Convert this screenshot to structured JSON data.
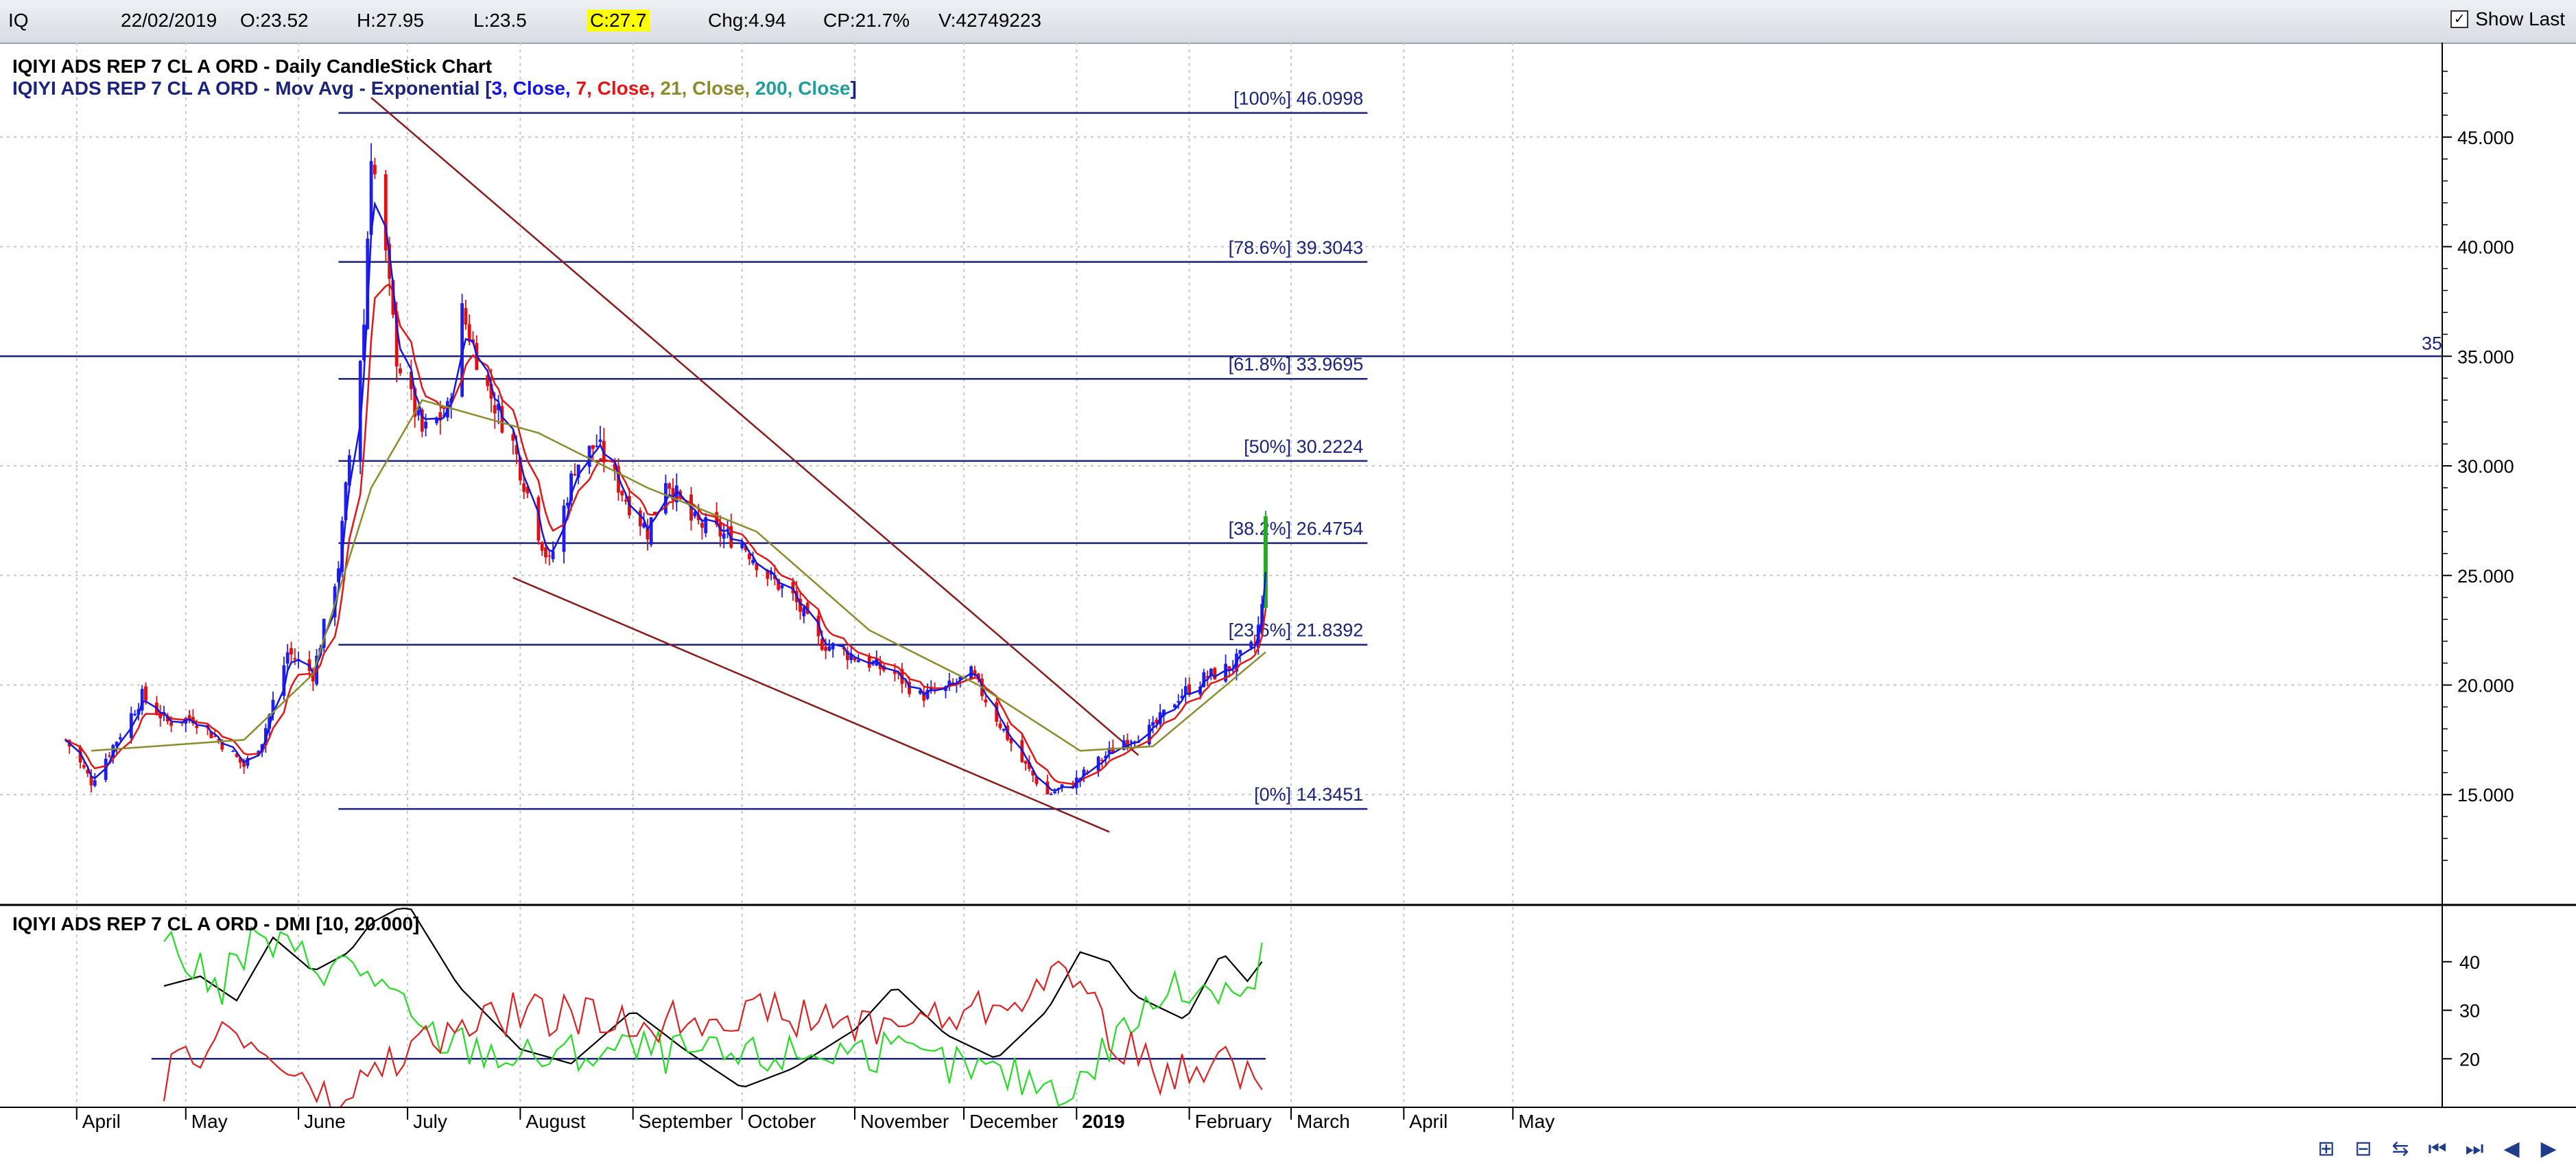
{
  "info_bar": {
    "symbol": "IQ",
    "date": "22/02/2019",
    "open": "O:23.52",
    "high": "H:27.95",
    "low": "L:23.5",
    "close": "C:27.7",
    "change": "Chg:4.94",
    "change_pct": "CP:21.7%",
    "volume": "V:42749223",
    "show_last_label": "Show Last",
    "show_last_checked": true
  },
  "colors": {
    "bull_candle": "#1e1ef0",
    "bear_candle": "#e01010",
    "ema3": "#1414e6",
    "ema7": "#e61414",
    "ema21": "#8c8c2d",
    "ema200": "#1e9e9e",
    "fib_lines": "#1a237e",
    "trend_lines": "#8b1a1a",
    "dmi_plus": "#22dd22",
    "dmi_minus": "#e02020",
    "adx": "#000000"
  },
  "legend": {
    "line1": "IQIYI ADS REP 7 CL A ORD - Daily CandleStick Chart",
    "line2_prefix": "IQIYI ADS REP 7 CL A ORD - Mov Avg - Exponential [",
    "p1": "3, Close, ",
    "p2": "7, Close, ",
    "p3": "21, Close, ",
    "p4": "200, Close",
    "line2_suffix": "]",
    "dmi": "IQIYI ADS REP 7 CL A ORD - DMI [10, 20.000]"
  },
  "chart_data": [
    {
      "type": "candlestick",
      "title": "IQIYI ADS REP 7 CL A ORD - Daily CandleStick Chart",
      "x_labels": [
        "April",
        "May",
        "June",
        "July",
        "August",
        "September",
        "October",
        "November",
        "December",
        "2019",
        "February",
        "March",
        "April",
        "May"
      ],
      "y_ticks": [
        "15.000",
        "20.000",
        "25.000",
        "30.000",
        "35.000",
        "40.000",
        "45.000"
      ],
      "ylim": [
        10.5,
        49
      ],
      "horizontal_line": {
        "value": 35,
        "label": "35"
      },
      "fibonacci_levels": [
        {
          "label": "[100%] 46.0998",
          "value": 46.0998
        },
        {
          "label": "[78.6%] 39.3043",
          "value": 39.3043
        },
        {
          "label": "[61.8%] 33.9695",
          "value": 33.9695
        },
        {
          "label": "[50%] 30.2224",
          "value": 30.2224
        },
        {
          "label": "[38.2%] 26.4754",
          "value": 26.4754
        },
        {
          "label": "[23.6%] 21.8392",
          "value": 21.8392
        },
        {
          "label": "[0%] 14.3451",
          "value": 14.3451
        }
      ],
      "trend_lines": [
        {
          "from": [
            "2018-06-21",
            46.8
          ],
          "to": [
            "2019-01-18",
            16.8
          ]
        },
        {
          "from": [
            "2018-07-30",
            24.9
          ],
          "to": [
            "2019-01-10",
            13.3
          ]
        }
      ],
      "price_path": [
        [
          "2018-03-29",
          17.5
        ],
        [
          "2018-04-05",
          15.6
        ],
        [
          "2018-04-12",
          17.5
        ],
        [
          "2018-04-19",
          19.5
        ],
        [
          "2018-04-26",
          18.3
        ],
        [
          "2018-05-03",
          18.5
        ],
        [
          "2018-05-10",
          17.5
        ],
        [
          "2018-05-17",
          16.3
        ],
        [
          "2018-05-22",
          17.5
        ],
        [
          "2018-05-29",
          21.5
        ],
        [
          "2018-06-05",
          20.5
        ],
        [
          "2018-06-12",
          25.5
        ],
        [
          "2018-06-15",
          30.5
        ],
        [
          "2018-06-19",
          36.5
        ],
        [
          "2018-06-21",
          44.5
        ],
        [
          "2018-06-25",
          39.5
        ],
        [
          "2018-06-28",
          35.0
        ],
        [
          "2018-07-05",
          31.5
        ],
        [
          "2018-07-12",
          32.5
        ],
        [
          "2018-07-16",
          37.0
        ],
        [
          "2018-07-23",
          33.5
        ],
        [
          "2018-07-30",
          31.0
        ],
        [
          "2018-08-06",
          27.0
        ],
        [
          "2018-08-09",
          25.5
        ],
        [
          "2018-08-16",
          30.0
        ],
        [
          "2018-08-22",
          31.0
        ],
        [
          "2018-08-30",
          28.5
        ],
        [
          "2018-09-05",
          27.0
        ],
        [
          "2018-09-10",
          29.5
        ],
        [
          "2018-09-17",
          27.5
        ],
        [
          "2018-09-24",
          27.0
        ],
        [
          "2018-10-01",
          26.5
        ],
        [
          "2018-10-08",
          25.0
        ],
        [
          "2018-10-15",
          24.0
        ],
        [
          "2018-10-22",
          22.0
        ],
        [
          "2018-10-29",
          21.5
        ],
        [
          "2018-11-05",
          21.0
        ],
        [
          "2018-11-12",
          20.5
        ],
        [
          "2018-11-19",
          19.5
        ],
        [
          "2018-11-26",
          19.8
        ],
        [
          "2018-12-03",
          20.5
        ],
        [
          "2018-12-10",
          18.5
        ],
        [
          "2018-12-17",
          16.5
        ],
        [
          "2018-12-24",
          15.0
        ],
        [
          "2018-12-31",
          15.5
        ],
        [
          "2019-01-07",
          16.5
        ],
        [
          "2019-01-14",
          17.5
        ],
        [
          "2019-01-22",
          18.0
        ],
        [
          "2019-01-29",
          19.5
        ],
        [
          "2019-02-05",
          20.3
        ],
        [
          "2019-02-12",
          20.8
        ],
        [
          "2019-02-19",
          21.8
        ],
        [
          "2019-02-21",
          23.5
        ],
        [
          "2019-02-22",
          27.7
        ]
      ],
      "ema21_path": [
        [
          "2018-04-05",
          17.0
        ],
        [
          "2018-05-17",
          17.5
        ],
        [
          "2018-06-05",
          20.5
        ],
        [
          "2018-06-21",
          29.0
        ],
        [
          "2018-07-05",
          33.0
        ],
        [
          "2018-08-06",
          31.5
        ],
        [
          "2018-09-05",
          29.0
        ],
        [
          "2018-10-05",
          27.0
        ],
        [
          "2018-11-05",
          22.5
        ],
        [
          "2018-12-05",
          20.0
        ],
        [
          "2019-01-02",
          17.0
        ],
        [
          "2019-01-22",
          17.2
        ],
        [
          "2019-02-22",
          21.5
        ]
      ]
    },
    {
      "type": "line",
      "title": "IQIYI ADS REP 7 CL A ORD - DMI [10, 20.000]",
      "y_ticks": [
        "20",
        "30",
        "40"
      ],
      "ylim": [
        10,
        51
      ],
      "threshold": 20,
      "series": [
        {
          "name": "ADX",
          "values": [
            [
              "2018-04-25",
              35
            ],
            [
              "2018-05-05",
              37
            ],
            [
              "2018-05-15",
              32
            ],
            [
              "2018-05-25",
              45
            ],
            [
              "2018-06-05",
              38
            ],
            [
              "2018-06-15",
              42
            ],
            [
              "2018-06-21",
              48
            ],
            [
              "2018-07-01",
              52
            ],
            [
              "2018-07-15",
              35
            ],
            [
              "2018-08-01",
              22
            ],
            [
              "2018-08-15",
              19
            ],
            [
              "2018-09-01",
              30
            ],
            [
              "2018-09-15",
              22
            ],
            [
              "2018-10-01",
              14
            ],
            [
              "2018-10-15",
              18
            ],
            [
              "2018-11-01",
              26
            ],
            [
              "2018-11-12",
              35
            ],
            [
              "2018-11-26",
              25
            ],
            [
              "2018-12-10",
              20
            ],
            [
              "2018-12-24",
              30
            ],
            [
              "2019-01-02",
              42
            ],
            [
              "2019-01-10",
              40
            ],
            [
              "2019-01-17",
              33
            ],
            [
              "2019-01-31",
              28
            ],
            [
              "2019-02-10",
              42
            ],
            [
              "2019-02-17",
              36
            ],
            [
              "2019-02-22",
              41
            ]
          ]
        },
        {
          "name": "+DI",
          "values": [
            [
              "2018-04-25",
              45
            ],
            [
              "2018-05-10",
              34
            ],
            [
              "2018-05-20",
              45
            ],
            [
              "2018-06-05",
              40
            ],
            [
              "2018-06-21",
              38
            ],
            [
              "2018-07-05",
              25
            ],
            [
              "2018-08-01",
              20
            ],
            [
              "2018-09-01",
              22
            ],
            [
              "2018-10-01",
              20
            ],
            [
              "2018-11-01",
              22
            ],
            [
              "2018-12-01",
              18
            ],
            [
              "2019-01-01",
              14
            ],
            [
              "2019-01-12",
              25
            ],
            [
              "2019-01-25",
              33
            ],
            [
              "2019-02-10",
              36
            ],
            [
              "2019-02-20",
              33
            ],
            [
              "2019-02-22",
              51
            ]
          ]
        },
        {
          "name": "-DI",
          "values": [
            [
              "2018-04-25",
              15
            ],
            [
              "2018-05-10",
              26
            ],
            [
              "2018-05-25",
              20
            ],
            [
              "2018-06-10",
              10
            ],
            [
              "2018-07-01",
              22
            ],
            [
              "2018-08-01",
              30
            ],
            [
              "2018-09-01",
              27
            ],
            [
              "2018-10-01",
              30
            ],
            [
              "2018-11-01",
              27
            ],
            [
              "2018-12-01",
              29
            ],
            [
              "2019-01-01",
              38
            ],
            [
              "2019-01-10",
              26
            ],
            [
              "2019-01-25",
              15
            ],
            [
              "2019-02-08",
              21
            ],
            [
              "2019-02-22",
              14
            ]
          ]
        }
      ]
    }
  ]
}
